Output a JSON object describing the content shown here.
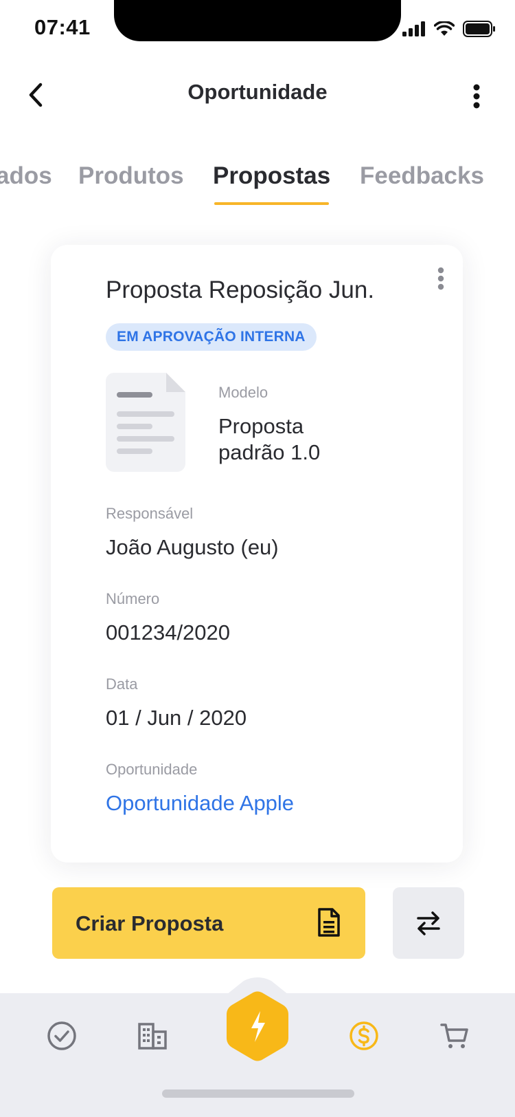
{
  "status_bar": {
    "time": "07:41"
  },
  "header": {
    "title": "Oportunidade",
    "back_icon": "chevron-left-icon",
    "menu_icon": "more-vertical-icon"
  },
  "tabs": [
    {
      "label": "ados",
      "active": false
    },
    {
      "label": "Produtos",
      "active": false
    },
    {
      "label": "Propostas",
      "active": true
    },
    {
      "label": "Feedbacks",
      "active": false
    }
  ],
  "colors": {
    "accent": "#f7b529",
    "primary_button": "#fbd04c",
    "link": "#2f74e6",
    "badge_bg": "#dbe8fb"
  },
  "proposal": {
    "title": "Proposta Reposição Jun.",
    "status": "EM APROVAÇÃO INTERNA",
    "model": {
      "label": "Modelo",
      "value_line1": "Proposta",
      "value_line2": "padrão 1.0"
    },
    "fields": [
      {
        "label": "Responsável",
        "value": "João Augusto (eu)"
      },
      {
        "label": "Número",
        "value": "001234/2020"
      },
      {
        "label": "Data",
        "value": "01 / Jun / 2020"
      }
    ],
    "opportunity": {
      "label": "Oportunidade",
      "value": "Oportunidade Apple"
    }
  },
  "actions": {
    "create_label": "Criar Proposta",
    "create_icon": "document-icon",
    "swap_icon": "swap-arrows-icon"
  },
  "bottom_nav": [
    {
      "name": "tasks",
      "icon": "check-circle-icon"
    },
    {
      "name": "companies",
      "icon": "building-icon"
    },
    {
      "name": "center",
      "icon": "lightning-icon"
    },
    {
      "name": "opportunities",
      "icon": "dollar-circle-icon",
      "active": true
    },
    {
      "name": "cart",
      "icon": "cart-icon"
    }
  ]
}
